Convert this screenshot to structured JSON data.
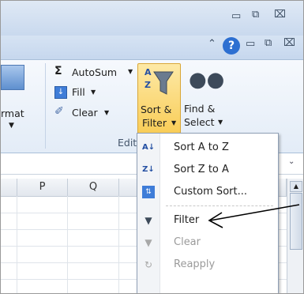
{
  "window": {
    "minimize_icon": "minimize-icon",
    "restore_icon": "restore-icon",
    "close_icon": "close-icon"
  },
  "ribbon": {
    "autosum_label": "AutoSum",
    "fill_label": "Fill",
    "clear_label": "Clear",
    "sort_filter_label_1": "Sort &",
    "sort_filter_label_2": "Filter",
    "find_select_label_1": "Find &",
    "find_select_label_2": "Select",
    "format_partial": "rmat",
    "group_label_partial": "Edit"
  },
  "columns": [
    "P",
    "Q"
  ],
  "menu": {
    "items": [
      {
        "label": "Sort A to Z",
        "enabled": true
      },
      {
        "label": "Sort Z to A",
        "enabled": true
      },
      {
        "label": "Custom Sort...",
        "enabled": true
      },
      {
        "label": "Filter",
        "enabled": true
      },
      {
        "label": "Clear",
        "enabled": false
      },
      {
        "label": "Reapply",
        "enabled": false
      }
    ]
  },
  "colors": {
    "sort_button_highlight": "#f9cd58",
    "menu_border": "#8f9fb5",
    "arrow": "#000000"
  }
}
